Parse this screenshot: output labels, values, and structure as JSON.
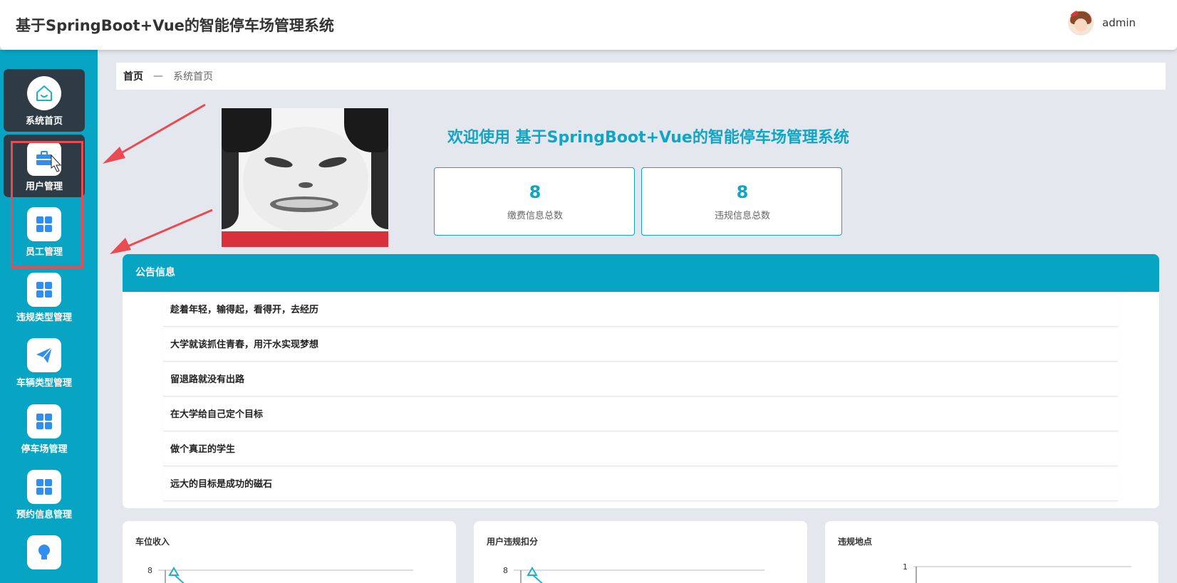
{
  "header": {
    "title": "基于SpringBoot+Vue的智能停车场管理系统",
    "username": "admin"
  },
  "sidebar": {
    "items": [
      {
        "label": "系统首页",
        "icon": "home-icon",
        "active": true
      },
      {
        "label": "用户管理",
        "icon": "briefcase-icon",
        "active": false
      },
      {
        "label": "员工管理",
        "icon": "grid-icon",
        "active": false
      },
      {
        "label": "违规类型管理",
        "icon": "grid-icon",
        "active": false
      },
      {
        "label": "车辆类型管理",
        "icon": "paper-plane-icon",
        "active": false
      },
      {
        "label": "停车场管理",
        "icon": "grid-icon",
        "active": false
      },
      {
        "label": "预约信息管理",
        "icon": "grid-icon",
        "active": false
      },
      {
        "label": "",
        "icon": "lightbulb-icon",
        "active": false
      }
    ]
  },
  "breadcrumb": {
    "home": "首页",
    "separator": "—",
    "current": "系统首页"
  },
  "welcome": {
    "text": "欢迎使用 基于SpringBoot+Vue的智能停车场管理系统"
  },
  "stats": [
    {
      "value": "8",
      "label": "缴费信息总数"
    },
    {
      "value": "8",
      "label": "违规信息总数"
    }
  ],
  "notices": {
    "title": "公告信息",
    "items": [
      "趁着年轻，输得起，看得开，去经历",
      "大学就该抓住青春，用汗水实现梦想",
      "留退路就没有出路",
      "在大学给自己定个目标",
      "做个真正的学生",
      "远大的目标是成功的磁石"
    ]
  },
  "charts": [
    {
      "title": "车位收入",
      "ymax": "8"
    },
    {
      "title": "用户违规扣分",
      "ymax": "8"
    },
    {
      "title": "违规地点",
      "ymax": "1"
    }
  ],
  "colors": {
    "accent": "#07a5c3",
    "active_nav": "#2e3b45",
    "annotation": "#ea4a52"
  }
}
